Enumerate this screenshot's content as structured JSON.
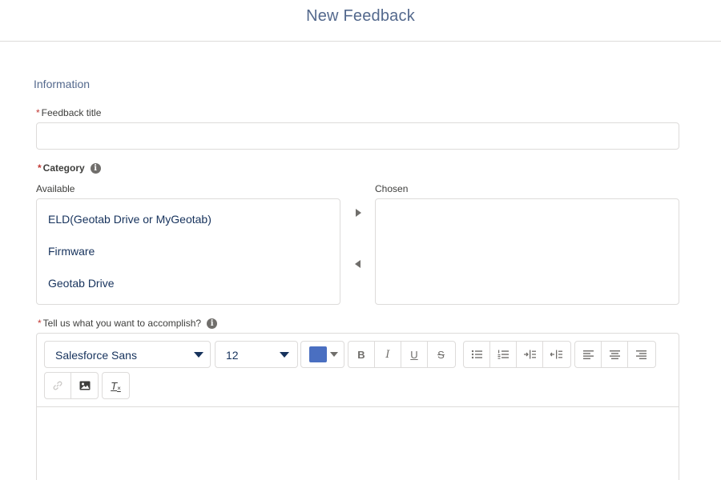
{
  "header": {
    "title": "New Feedback"
  },
  "section": {
    "title": "Information"
  },
  "feedback_title": {
    "required_mark": "*",
    "label": "Feedback title",
    "value": "",
    "placeholder": ""
  },
  "category": {
    "required_mark": "*",
    "label": "Category",
    "info_icon": "info-icon",
    "available_label": "Available",
    "chosen_label": "Chosen",
    "available": [
      "ELD(Geotab Drive or MyGeotab)",
      "Firmware",
      "Geotab Drive"
    ],
    "chosen": []
  },
  "accomplish": {
    "required_mark": "*",
    "label": "Tell us what you want to accomplish?",
    "info_icon": "info-icon"
  },
  "toolbar": {
    "font_family": "Salesforce Sans",
    "font_size": "12",
    "text_color": "#4a6fc1",
    "bold": "B",
    "italic": "I",
    "underline": "U",
    "strikethrough": "S",
    "clear_format": "T"
  }
}
